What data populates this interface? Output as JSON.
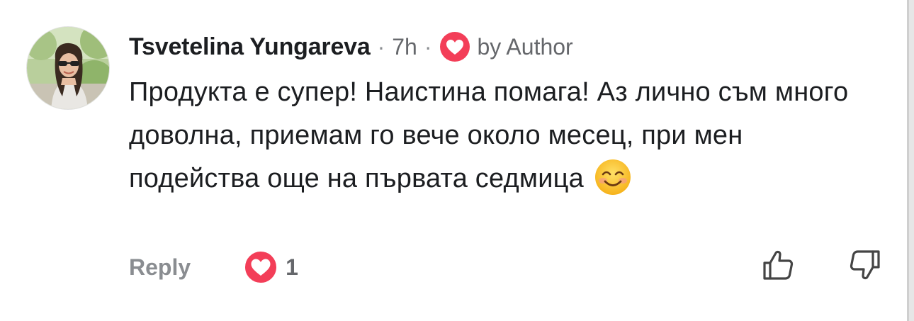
{
  "comment": {
    "author": "Tsvetelina Yungareva",
    "separator": "·",
    "time": "7h",
    "liked_by": "by Author",
    "text": "Продукта е супер! Наистина помага! Аз лично съм много доволна, приемам го вече около месец, при мен подейства още на първата седмица",
    "emoji": "smiling-face-with-smiling-eyes"
  },
  "actions": {
    "reply_label": "Reply",
    "reaction_count": "1"
  },
  "colors": {
    "heart": "#f33e58",
    "text": "#1c1e21",
    "muted": "#65676b"
  }
}
